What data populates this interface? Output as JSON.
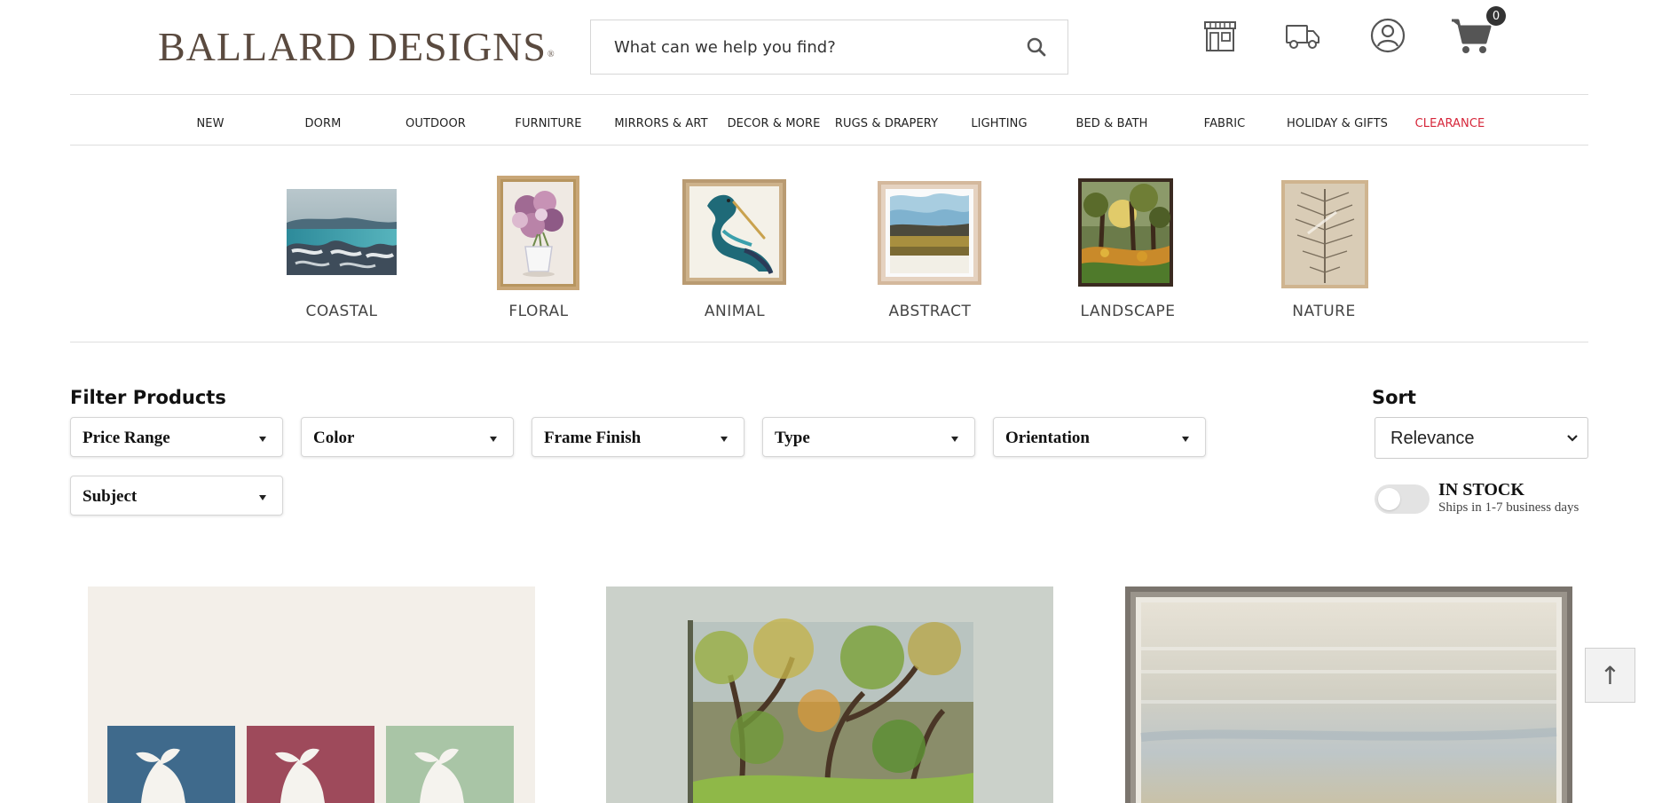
{
  "header": {
    "logo_text": "BALLARD DESIGNS",
    "logo_mark": "®",
    "search_placeholder": "What can we help you find?",
    "cart_count": "0",
    "icons": [
      "store-icon",
      "truck-icon",
      "account-icon",
      "cart-icon",
      "search-icon"
    ]
  },
  "nav": {
    "items": [
      "NEW",
      "DORM",
      "OUTDOOR",
      "FURNITURE",
      "MIRRORS & ART",
      "DECOR & MORE",
      "RUGS & DRAPERY",
      "LIGHTING",
      "BED & BATH",
      "FABRIC",
      "HOLIDAY & GIFTS",
      "CLEARANCE"
    ],
    "highlight_color": "#d6263a"
  },
  "categories": [
    {
      "label": "COASTAL"
    },
    {
      "label": "FLORAL"
    },
    {
      "label": "ANIMAL"
    },
    {
      "label": "ABSTRACT"
    },
    {
      "label": "LANDSCAPE"
    },
    {
      "label": "NATURE"
    }
  ],
  "filters": {
    "title": "Filter Products",
    "dropdowns": [
      "Price Range",
      "Color",
      "Frame Finish",
      "Type",
      "Orientation",
      "Subject"
    ]
  },
  "sort": {
    "title": "Sort",
    "selected": "Relevance"
  },
  "stock": {
    "label": "IN STOCK",
    "sublabel": "Ships in 1-7 business days",
    "enabled": false
  },
  "back_to_top": "↑",
  "colors": {
    "logo": "#5a4a3f",
    "clearance": "#d6263a",
    "text": "#222222"
  }
}
